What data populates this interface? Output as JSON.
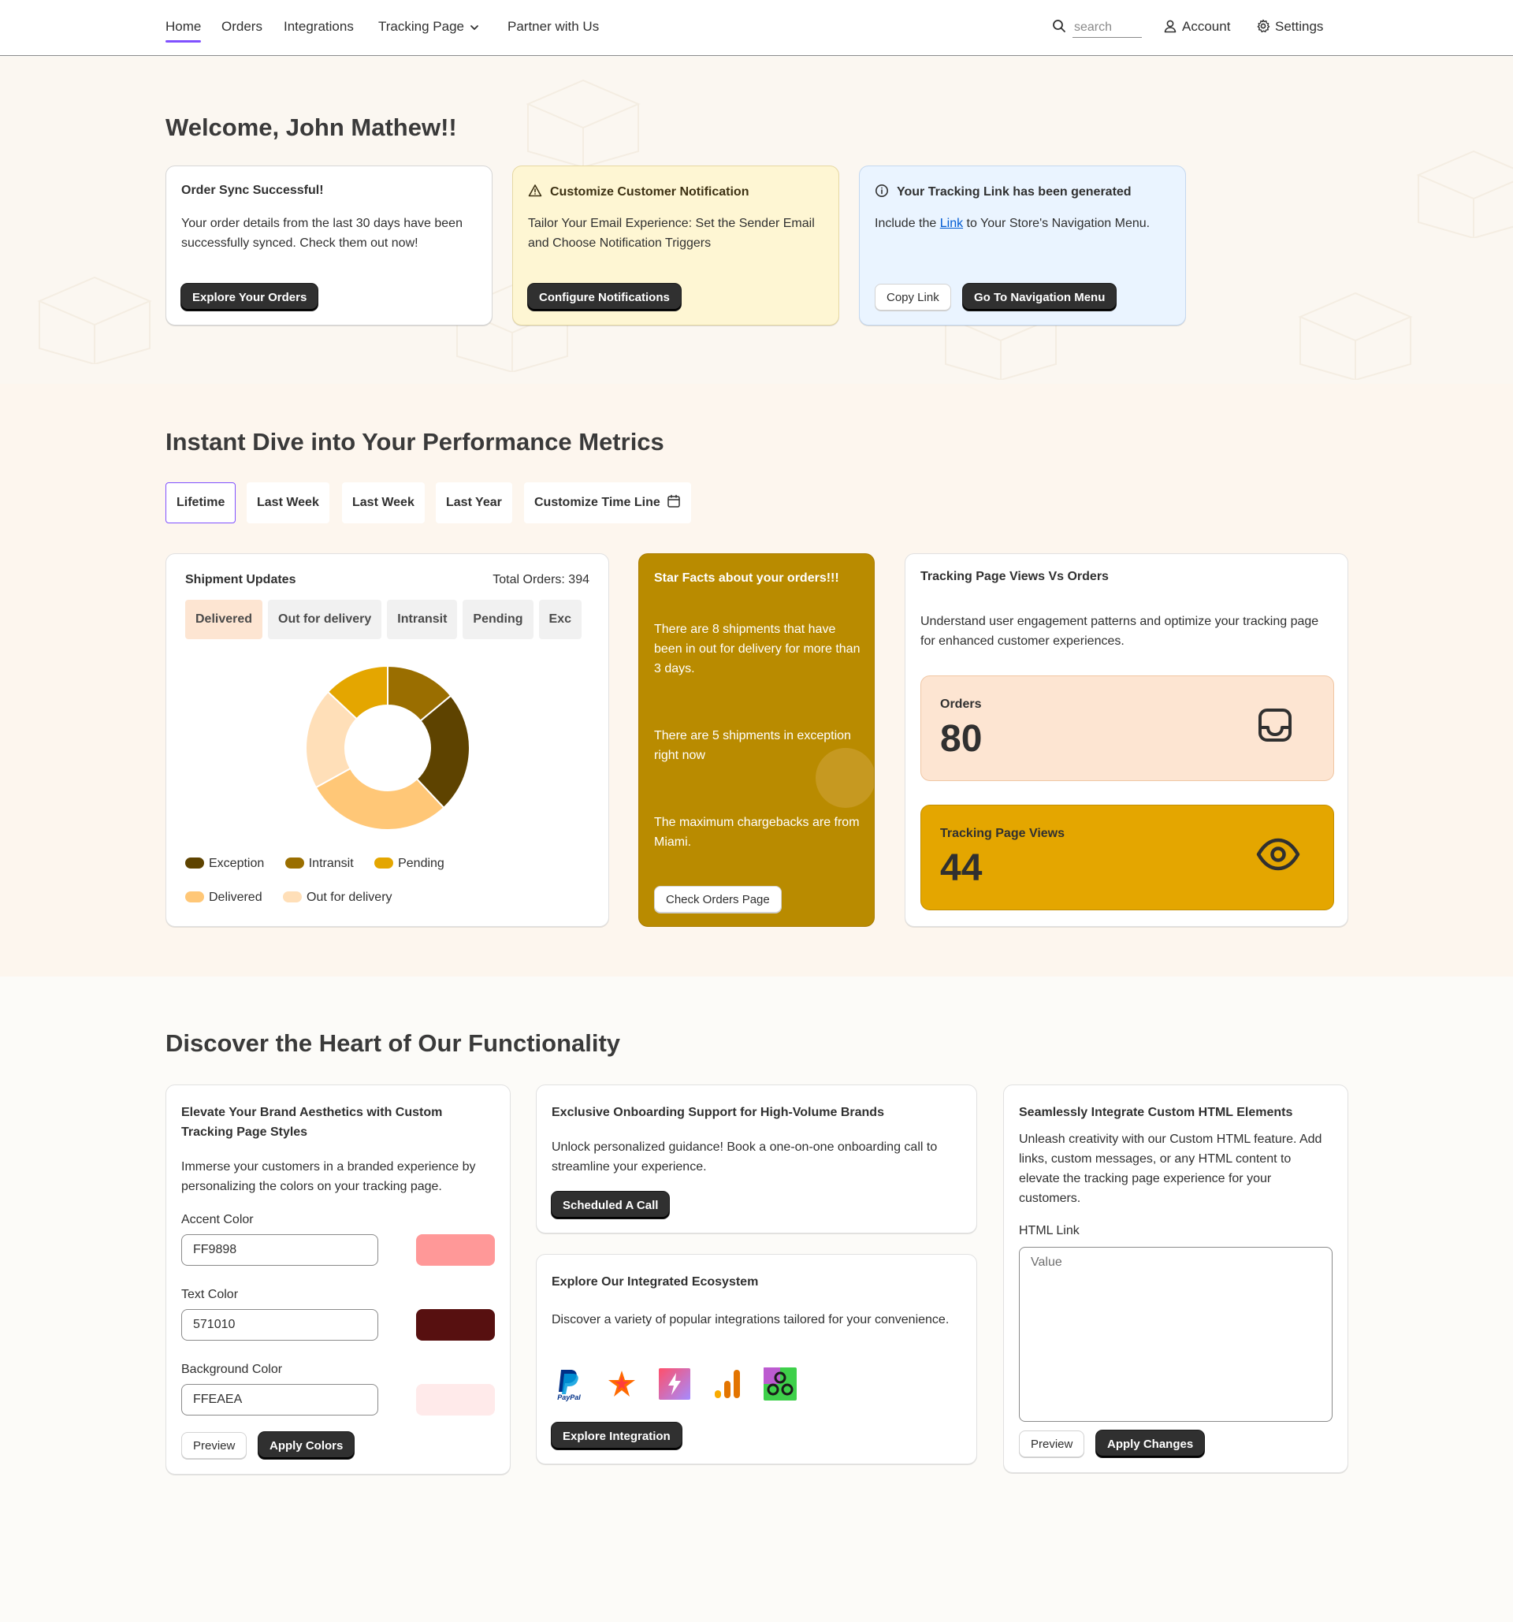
{
  "nav": {
    "items": [
      "Home",
      "Orders",
      "Integrations",
      "Tracking Page",
      "Partner with Us"
    ],
    "search_placeholder": "search",
    "account": "Account",
    "settings": "Settings",
    "accent_color": "#8051ff"
  },
  "welcome": {
    "title": "Welcome, John Mathew!!",
    "cards": [
      {
        "title": "Order Sync Successful!",
        "body": "Your order details from the last 30 days have been successfully synced. Check them out now!",
        "button": "Explore Your Orders"
      },
      {
        "title": "Customize Customer Notification",
        "icon": "warning-icon",
        "body": "Tailor Your Email Experience: Set the Sender Email and Choose Notification Triggers",
        "button": "Configure Notifications"
      },
      {
        "title": "Your Tracking Link has been generated",
        "icon": "info-icon",
        "body_prefix": "Include the",
        "body_link": "Link",
        "body_suffix": "to Your Store's Navigation Menu.",
        "button_secondary": "Copy Link",
        "button_primary": "Go To Navigation Menu"
      }
    ]
  },
  "metrics": {
    "title": "Instant Dive into Your Performance Metrics",
    "tabs": [
      "Lifetime",
      "Last Week",
      "Last Week",
      "Last Year",
      "Customize Time Line"
    ],
    "active_tab": "Lifetime",
    "shipment": {
      "title": "Shipment Updates",
      "total": "Total Orders: 394",
      "chips": [
        "Delivered",
        "Out for delivery",
        "Intransit",
        "Pending",
        "Exc"
      ]
    },
    "star_facts": {
      "title": "Star Facts about your orders!!!",
      "facts": [
        "There are 8 shipments that have been in out for delivery for more than 3 days.",
        "There are 5 shipments in exception right now",
        "The maximum chargebacks are from Miami."
      ],
      "button": "Check Orders Page"
    },
    "tracking": {
      "title": "Tracking Page Views Vs Orders",
      "description": "Understand user engagement patterns and optimize your tracking page for enhanced customer experiences.",
      "orders_label": "Orders",
      "orders_value": "80",
      "views_label": "Tracking Page Views",
      "views_value": "44"
    }
  },
  "chart_data": {
    "type": "pie",
    "donut": true,
    "categories": [
      "Exception",
      "Intransit",
      "Pending",
      "Delivered",
      "Out for delivery"
    ],
    "values": [
      24,
      14,
      13,
      29,
      20
    ],
    "colors": [
      "#5e4300",
      "#9a6e00",
      "#e4a600",
      "#ffc777",
      "#ffdfb8"
    ],
    "legend_position": "bottom"
  },
  "features": {
    "title": "Discover the Heart of Our Functionality",
    "branding": {
      "title": "Elevate Your Brand Aesthetics with Custom Tracking Page Styles",
      "body": "Immerse your customers in a branded experience by personalizing the colors on your tracking page.",
      "fields": [
        {
          "label": "Accent Color",
          "value": "FF9898",
          "color": "#ff9898"
        },
        {
          "label": "Text Color",
          "value": "571010",
          "color": "#571010"
        },
        {
          "label": "Background Color",
          "value": "FFEAEA",
          "color": "#ffeaea"
        }
      ],
      "preview": "Preview",
      "apply": "Apply Colors"
    },
    "onboarding": {
      "title": "Exclusive Onboarding Support for High-Volume Brands",
      "body": "Unlock personalized guidance! Book a one-on-one onboarding call to streamline your experience.",
      "button": "Scheduled A Call"
    },
    "ecosystem": {
      "title": "Explore Our Integrated Ecosystem",
      "body": "Discover a variety of popular integrations tailored for your convenience.",
      "paypal_text": "PayPal",
      "icons": [
        "paypal-icon",
        "star-integration-icon",
        "lightning-integration-icon",
        "analytics-bars-icon",
        "network-integration-icon"
      ],
      "button": "Explore Integration"
    },
    "custom_html": {
      "title": "Seamlessly Integrate Custom HTML Elements",
      "body": "Unleash creativity with our Custom HTML feature. Add links, custom messages, or any HTML content to elevate the tracking page experience for your customers.",
      "field_label": "HTML Link",
      "placeholder": "Value",
      "preview": "Preview",
      "apply": "Apply Changes"
    }
  }
}
